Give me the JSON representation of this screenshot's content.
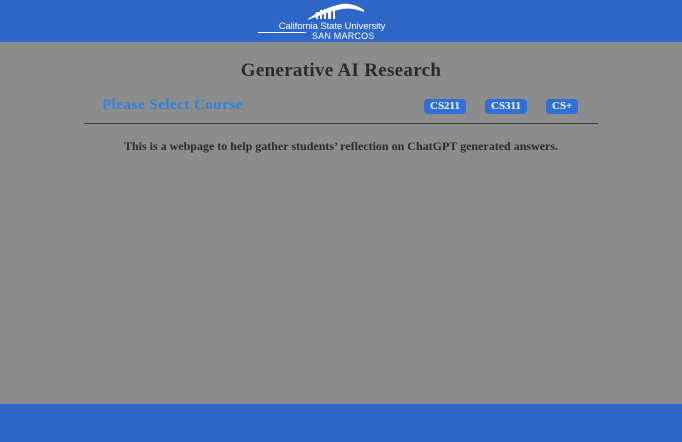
{
  "header": {
    "logo": {
      "icon": "university-skyline-logo",
      "line1": "California State University",
      "line2": "SAN MARCOS"
    }
  },
  "main": {
    "title": "Generative AI Research",
    "select_label": "Please Select Course",
    "courses": [
      "CS211",
      "CS311",
      "CS+"
    ],
    "intro": "This is a webpage to help gather students’ reflection on ChatGPT generated answers."
  },
  "colors": {
    "brand_blue": "#2e67c7",
    "accent_blue": "#2f7fe0",
    "background": "#8c8c8c",
    "text_dark": "#2b2b2b"
  }
}
